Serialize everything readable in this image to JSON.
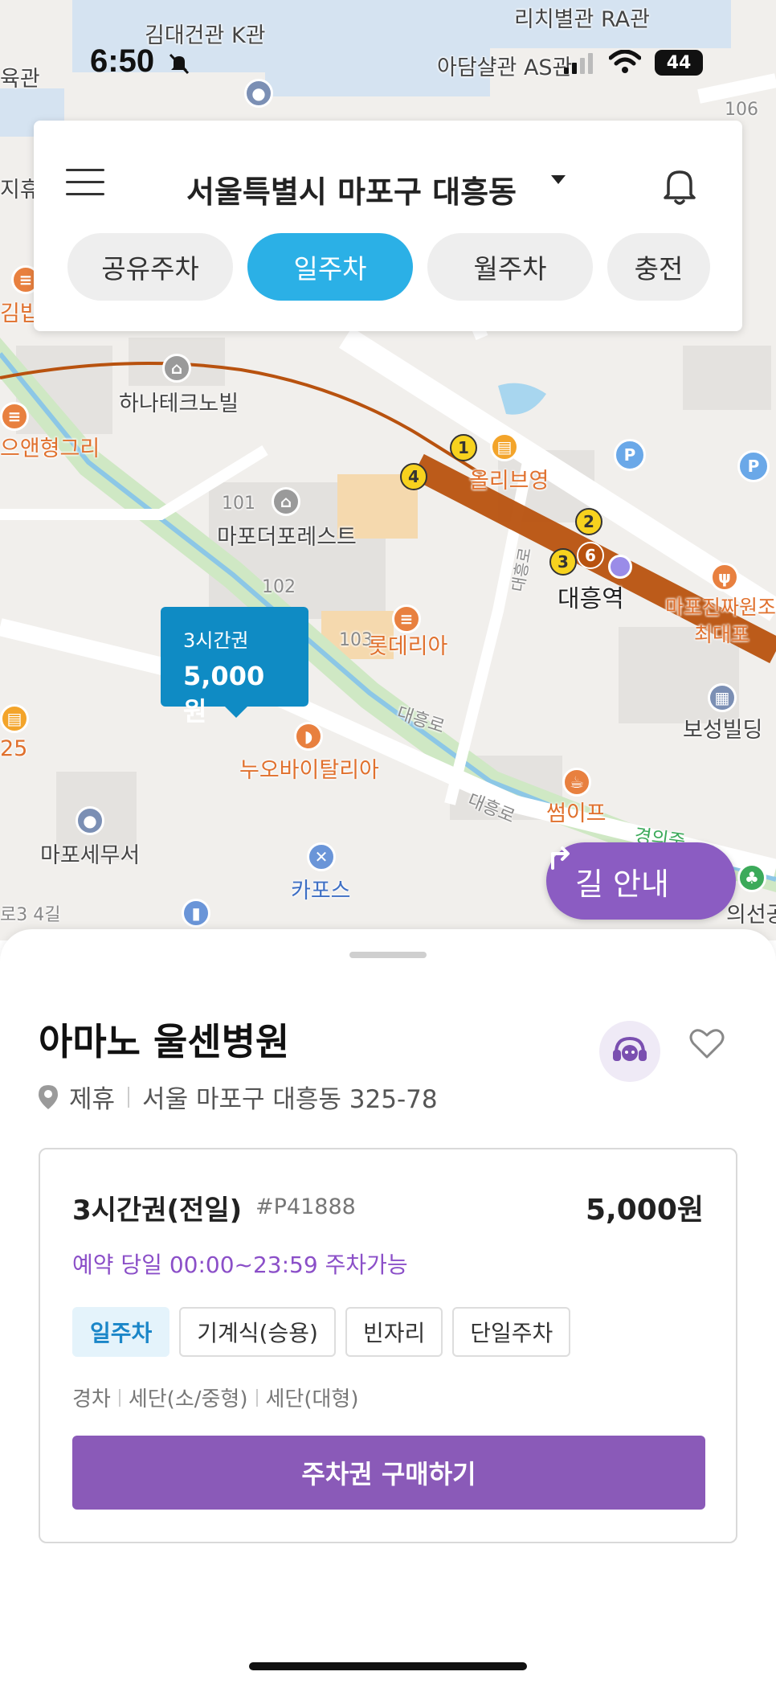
{
  "status_bar": {
    "time": "6:50",
    "battery": "44"
  },
  "map": {
    "labels": {
      "kimdae": "김대건관 K관",
      "richi": "리치별관 RA관",
      "adam": "아담샬관 AS관",
      "gyoyuk": "육관",
      "jijuk": "지휴",
      "hana": "하나테크노빌",
      "yaeng": "으앤형그리",
      "olive": "올리브영",
      "mapo_forest": "마포더포레스트",
      "n101": "101",
      "n102": "102",
      "n103": "103",
      "n106": "106",
      "lotteria": "롯데리아",
      "daeheung_station": "대흥역",
      "jinjja": "마포진짜원조",
      "choedae": "최대포",
      "boseong": "보성빌딩",
      "daeheungro1": "대흥로",
      "daeheungro2": "대흥로",
      "daeheungro3": "대흥로",
      "nuo": "누오바이탈리아",
      "sseomipeu": "썸이프",
      "mapo_tax": "마포세무서",
      "carpos": "카포스",
      "gil34": "로3 4길",
      "n25": "25",
      "gyeongui": "경의중",
      "gyeongui2": "의선공",
      "gimbap": "김밥"
    },
    "line_badges": [
      "1",
      "2",
      "3",
      "4"
    ],
    "station_badge": "6",
    "marker": {
      "title": "3시간권",
      "price": "5,000원"
    },
    "route_button": "길 안내"
  },
  "top_card": {
    "region": "서울특별시 마포구 대흥동",
    "tabs": [
      "공유주차",
      "일주차",
      "월주차",
      "충전"
    ],
    "active_tab": "일주차"
  },
  "sheet": {
    "title": "아마노 울센병원",
    "partner": "제휴",
    "address": "서울 마포구 대흥동 325-78",
    "ticket": {
      "name": "3시간권(전일)",
      "code": "#P41888",
      "price": "5,000원",
      "availability": "예약 당일 00:00~23:59 주차가능",
      "chips": [
        "일주차",
        "기계식(승용)",
        "빈자리",
        "단일주차"
      ],
      "car_types": [
        "경차",
        "세단(소/중형)",
        "세단(대형)"
      ],
      "buy_button": "주차권 구매하기"
    }
  },
  "colors": {
    "accent_blue": "#2bb0e6",
    "marker_blue": "#0f8bc4",
    "purple": "#8a5ab8",
    "subway_line": "#b8520f",
    "poi_orange": "#e0702d"
  }
}
